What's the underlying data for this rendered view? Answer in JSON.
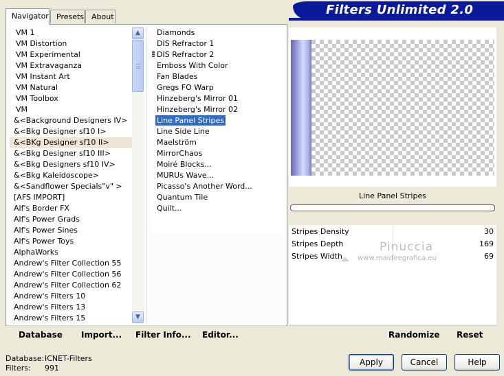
{
  "tabs": [
    "Navigator",
    "Presets",
    "About"
  ],
  "title": "Filters Unlimited 2.0",
  "categories": [
    "VM 1",
    "VM Distortion",
    "VM Experimental",
    "VM Extravaganza",
    "VM Instant Art",
    "VM Natural",
    "VM Toolbox",
    "VM",
    "&<Background Designers IV>",
    "&<Bkg Designer sf10 I>",
    "&<BKg Designer sf10 II>",
    "&<Bkg Designer sf10 III>",
    "&<Bkg Designers sf10 IV>",
    "&<Bkg Kaleidoscope>",
    "&<Sandflower Specials\"v\" >",
    "[AFS IMPORT]",
    "Alf's Border FX",
    "Alf's Power Grads",
    "Alf's Power Sines",
    "Alf's Power Toys",
    "AlphaWorks",
    "Andrew's Filter Collection 55",
    "Andrew's Filter Collection 56",
    "Andrew's Filter Collection 62",
    "Andrew's Filters 10",
    "Andrew's Filters 13",
    "Andrew's Filters 15"
  ],
  "filters": [
    "Diamonds",
    "DIS Refractor 1",
    "DIS Refractor 2",
    "Emboss With Color",
    "Fan Blades",
    "Gregs FO Warp",
    "Hinzeberg's Mirror 01",
    "Hinzeberg's Mirror 02",
    "Line Panel Stripes",
    "Line Side Line",
    "Maelström",
    "MirrorChaos",
    "Moiré Blocks...",
    "MURUs Wave...",
    "Picasso's Another Word...",
    "Quantum Tile",
    "Quilt..."
  ],
  "selected_category_index": 10,
  "selected_filter_index": 8,
  "filter_name": "Line Panel Stripes",
  "progress": 0,
  "params": [
    {
      "name": "Stripes Density",
      "value": "30"
    },
    {
      "name": "Stripes Depth",
      "value": "169"
    },
    {
      "name": "Stripes Width",
      "value": "69"
    }
  ],
  "watermark": {
    "name": "Pinuccia",
    "url": "www.maidiregrafica.eu"
  },
  "toolbar": {
    "database": "Database",
    "import": "Import...",
    "filter_info": "Filter Info...",
    "editor": "Editor...",
    "randomize": "Randomize",
    "reset": "Reset"
  },
  "status": {
    "database_label": "Database:",
    "database_value": "ICNET-Filters",
    "filters_label": "Filters:",
    "filters_value": "991"
  },
  "buttons": {
    "apply": "Apply",
    "cancel": "Cancel",
    "help": "Help"
  },
  "colors": {
    "banner": "#0a1a9a",
    "selection": "#316ac5",
    "preview_strip": "#8a86c8"
  }
}
